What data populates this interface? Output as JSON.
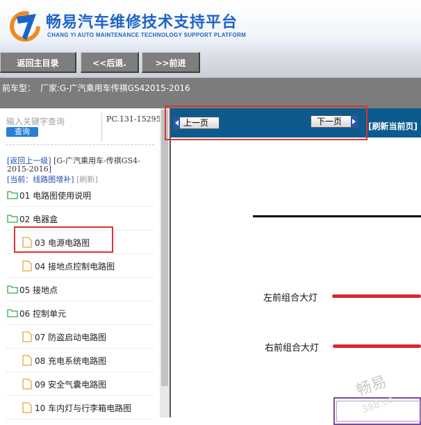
{
  "header": {
    "title": "畅易汽车维修技术支持平台",
    "subtitle": "CHANG YI AUTO MAINTENANCE TECHNOLOGY SUPPORT PLATFORM",
    "brand_color": "#1d63c6",
    "logo_icon": "changyi-logo-icon"
  },
  "nav": {
    "home": "返回主目录",
    "back": "<<后退.",
    "forward": ">>前进"
  },
  "model_bar": {
    "label": "前车型：",
    "value": "厂家:G-广汽乘用车传祺GS42015-2016"
  },
  "sidebar": {
    "search_placeholder": "输入关键字查询",
    "search_button": "查询",
    "pc_code": "PC.131-15295",
    "back_link": "[返回上一级]",
    "back_path": "[G-广汽乘用车-传祺GS4-2015-2016]",
    "current_label": "[当前：线路图增补]",
    "refresh_label": "[刷新]",
    "items": [
      {
        "label": "01 电路图使用说明",
        "type": "folder"
      },
      {
        "label": "02 电器盒",
        "type": "folder"
      },
      {
        "label": "03 电源电路图",
        "type": "file",
        "highlighted": true
      },
      {
        "label": "04 接地点控制电路图",
        "type": "file"
      },
      {
        "label": "05 接地点",
        "type": "folder"
      },
      {
        "label": "06 控制单元",
        "type": "folder"
      },
      {
        "label": "07 防盗启动电路图",
        "type": "file"
      },
      {
        "label": "08 充电系统电路图",
        "type": "file"
      },
      {
        "label": "09 安全气囊电路图",
        "type": "file"
      },
      {
        "label": "10 车内灯与行李箱电路图",
        "type": "file"
      }
    ]
  },
  "content": {
    "prev_page": "上一页",
    "next_page": "下一页",
    "refresh_page": "[刷新当前页]",
    "toolbar_color": "#0d5a8f",
    "components": [
      {
        "label": "左前组合大灯"
      },
      {
        "label": "右前组合大灯"
      }
    ],
    "watermark": "畅易",
    "watermark_sub": "388.co"
  },
  "colors": {
    "highlight_red": "#d9342b",
    "wire_red": "#d6282e",
    "folder_green": "#3fa34d",
    "file_orange": "#e6a23c"
  }
}
